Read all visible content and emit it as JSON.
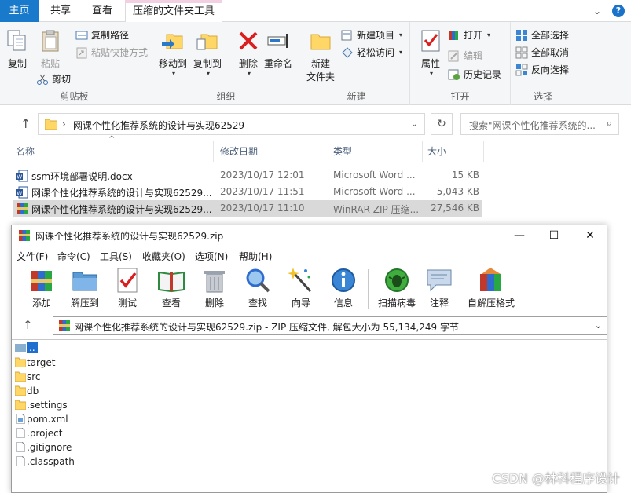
{
  "explorer": {
    "tabs": [
      "主页",
      "共享",
      "查看",
      "压缩的文件夹工具"
    ],
    "ribbon": {
      "clipboard": {
        "label": "剪贴板",
        "copy": "复制",
        "paste": "粘贴",
        "copy_path": "复制路径",
        "paste_shortcut": "粘贴快捷方式",
        "cut": "剪切"
      },
      "organize": {
        "label": "组织",
        "move_to": "移动到",
        "copy_to": "复制到",
        "delete": "删除",
        "rename": "重命名"
      },
      "new": {
        "label": "新建",
        "new_folder": "新建\n文件夹",
        "new_item": "新建项目",
        "easy_access": "轻松访问"
      },
      "open": {
        "label": "打开",
        "properties": "属性",
        "open": "打开",
        "edit": "编辑",
        "history": "历史记录"
      },
      "select": {
        "label": "选择",
        "select_all": "全部选择",
        "select_none": "全部取消",
        "invert": "反向选择"
      }
    },
    "address": {
      "path": "网课个性化推荐系统的设计与实现62529",
      "search_placeholder": "搜索\"网课个性化推荐系统的..."
    },
    "columns": [
      "名称",
      "修改日期",
      "类型",
      "大小"
    ],
    "files": [
      {
        "name": "ssm环境部署说明.docx",
        "date": "2023/10/17 12:01",
        "type": "Microsoft Word ...",
        "size": "15 KB",
        "icon": "word-icon",
        "selected": false
      },
      {
        "name": "网课个性化推荐系统的设计与实现62529...",
        "date": "2023/10/17 11:51",
        "type": "Microsoft Word ...",
        "size": "5,043 KB",
        "icon": "word-icon",
        "selected": false
      },
      {
        "name": "网课个性化推荐系统的设计与实现62529...",
        "date": "2023/10/17 11:10",
        "type": "WinRAR ZIP 压缩...",
        "size": "27,546 KB",
        "icon": "winrar-icon",
        "selected": true
      }
    ]
  },
  "winrar": {
    "title": "网课个性化推荐系统的设计与实现62529.zip",
    "menu": [
      "文件(F)",
      "命令(C)",
      "工具(S)",
      "收藏夹(O)",
      "选项(N)",
      "帮助(H)"
    ],
    "toolbar": [
      "添加",
      "解压到",
      "测试",
      "查看",
      "删除",
      "查找",
      "向导",
      "信息",
      "扫描病毒",
      "注释",
      "自解压格式"
    ],
    "path_text": "网课个性化推荐系统的设计与实现62529.zip - ZIP 压缩文件, 解包大小为 55,134,249 字节",
    "items": [
      {
        "name": "..",
        "kind": "up"
      },
      {
        "name": "target",
        "kind": "folder"
      },
      {
        "name": "src",
        "kind": "folder"
      },
      {
        "name": "db",
        "kind": "folder"
      },
      {
        "name": ".settings",
        "kind": "folder"
      },
      {
        "name": "pom.xml",
        "kind": "file"
      },
      {
        "name": ".project",
        "kind": "file"
      },
      {
        "name": ".gitignore",
        "kind": "file"
      },
      {
        "name": ".classpath",
        "kind": "file"
      }
    ]
  },
  "watermark": "CSDN @林科程序设计",
  "colors": {
    "ribbon_home_tab": "#1979ca",
    "selection_gray": "#d9d9d9",
    "winrar_highlight": "#1e6fd0",
    "folder_yellow": "#ffd766"
  }
}
